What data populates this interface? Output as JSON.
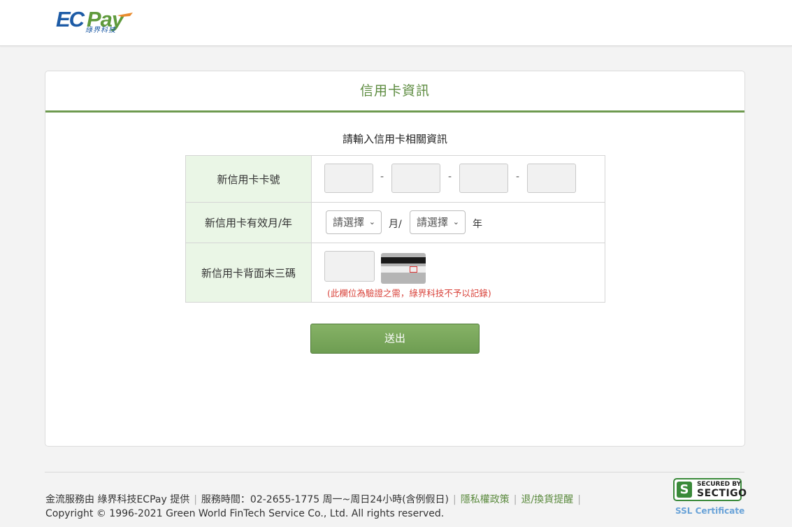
{
  "brand": {
    "logo_main": "EC",
    "logo_accent": "Pay",
    "logo_sub": "綠界科技"
  },
  "card": {
    "title": "信用卡資訊",
    "prompt": "請輸入信用卡相關資訊"
  },
  "form": {
    "card_number_label": "新信用卡卡號",
    "card_number_separator": "-",
    "expiry_label": "新信用卡有效月/年",
    "month_select_value": "請選擇",
    "month_unit": "月/",
    "year_select_value": "請選擇",
    "year_unit": "年",
    "cvv_label": "新信用卡背面末三碼",
    "cvv_note": "(此欄位為驗證之需，綠界科技不予以記錄)"
  },
  "submit_label": "送出",
  "footer": {
    "provider": "金流服務由 綠界科技ECPay 提供",
    "hours": "服務時間：02-2655-1775 周一~周日24小時(含例假日)",
    "privacy_link": "隱私權政策",
    "return_link": "退/換貨提醒",
    "copyright": "Copyright © 1996-2021 Green World FinTech Service Co., Ltd. All rights reserved.",
    "separator": "|"
  },
  "security_badge": {
    "letter": "S",
    "line1": "SECURED BY",
    "line2": "SECTIGO",
    "caption": "SSL Certificate"
  },
  "colors": {
    "brand_green": "#5c8b3f",
    "brand_blue": "#1d5ba6",
    "label_bg": "#eaf6e6",
    "note_red": "#d9443c"
  }
}
